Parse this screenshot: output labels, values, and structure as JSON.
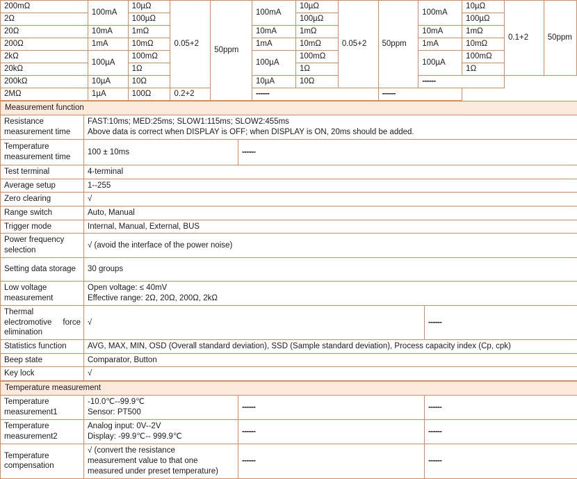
{
  "spec_table": {
    "top_ranges": {
      "group_a": {
        "ranges": [
          "200mΩ",
          "2Ω",
          "20Ω",
          "200Ω",
          "2kΩ",
          "20kΩ",
          "200kΩ",
          "2MΩ"
        ],
        "currents": [
          {
            "label": "100mA",
            "span": 2
          },
          {
            "label": "10mA",
            "span": 1
          },
          {
            "label": "1mA",
            "span": 1
          },
          {
            "label": "100µA",
            "span": 2
          },
          {
            "label": "10µA",
            "span": 1
          },
          {
            "label": "1µA",
            "span": 1
          }
        ],
        "resolutions": [
          "10µΩ",
          "100µΩ",
          "1mΩ",
          "10mΩ",
          "100mΩ",
          "1Ω",
          "10Ω",
          "100Ω"
        ],
        "accuracy_main": "0.05+2",
        "accuracy_last": "0.2+2",
        "tempco": "50ppm"
      },
      "group_b": {
        "currents": [
          {
            "label": "100mA",
            "span": 2
          },
          {
            "label": "10mA",
            "span": 1
          },
          {
            "label": "1mA",
            "span": 1
          },
          {
            "label": "100µA",
            "span": 2
          },
          {
            "label": "10µA",
            "span": 1
          }
        ],
        "resolutions": [
          "10µΩ",
          "100µΩ",
          "1mΩ",
          "10mΩ",
          "100mΩ",
          "1Ω",
          "10Ω"
        ],
        "last_dash": "------",
        "accuracy_main": "0.05+2",
        "tempco": "50ppm"
      },
      "group_c": {
        "currents": [
          {
            "label": "100mA",
            "span": 2
          },
          {
            "label": "10mA",
            "span": 1
          },
          {
            "label": "1mA",
            "span": 1
          },
          {
            "label": "100µA",
            "span": 2
          }
        ],
        "resolutions": [
          "10µΩ",
          "100µΩ",
          "1mΩ",
          "10mΩ",
          "100mΩ",
          "1Ω"
        ],
        "dash_rows": [
          "------",
          "------"
        ],
        "accuracy_main": "0.1+2",
        "tempco": "50ppm"
      }
    },
    "measurement_function": {
      "section_title": "Measurement function",
      "rows": [
        {
          "label": "Resistance measurement time",
          "value_line1": "FAST:10ms; MED:25ms; SLOW1:115ms; SLOW2:455ms",
          "value_line2": "Above data is correct when DISPLAY is OFF; when DISPLAY is ON, 20ms should be added.",
          "split": false
        },
        {
          "label": "Temperature measurement time",
          "value_line1": "100 ± 10ms",
          "value_line2": "",
          "split": true,
          "right_value": "------"
        },
        {
          "label": "Test terminal",
          "value_line1": "4-terminal",
          "value_line2": "",
          "split": false
        },
        {
          "label": "Average setup",
          "value_line1": "1--255",
          "value_line2": "",
          "split": false
        },
        {
          "label": "Zero clearing",
          "value_line1": "√",
          "value_line2": "",
          "split": false
        },
        {
          "label": "Range switch",
          "value_line1": "Auto, Manual",
          "value_line2": "",
          "split": false
        },
        {
          "label": "Trigger mode",
          "value_line1": "Internal, Manual, External, BUS",
          "value_line2": "",
          "split": false
        },
        {
          "label": "Power frequency selection",
          "value_line1": "√ (avoid the interface of the power noise)",
          "value_line2": "",
          "split": false
        },
        {
          "label": "Setting data storage",
          "value_line1": "30 groups",
          "value_line2": "",
          "split": false
        },
        {
          "label": "Low voltage measurement",
          "value_line1": "Open voltage: ≤ 40mV",
          "value_line2": "Effective range: 2Ω, 20Ω, 200Ω, 2kΩ",
          "split": false
        },
        {
          "label": "Thermal electromotive force elimination",
          "value_line1": "√",
          "value_line2": "",
          "split": true,
          "right_value": "------"
        },
        {
          "label": "Statistics function",
          "value_line1": "AVG, MAX, MIN, OSD (Overall standard deviation), SSD (Sample standard deviation), Process capacity index (Cp, cpk)",
          "value_line2": "",
          "split": false
        },
        {
          "label": "Beep state",
          "value_line1": "Comparator, Button",
          "value_line2": "",
          "split": false
        },
        {
          "label": "Key lock",
          "value_line1": "√",
          "value_line2": "",
          "split": false
        }
      ]
    },
    "temperature_measurement": {
      "section_title": "Temperature measurement",
      "rows": [
        {
          "label": "Temperature measurement1",
          "value_line1": "-10.0℃--99.9℃",
          "value_line2": "Sensor: PT500",
          "value_line3": "",
          "col3": "------",
          "col4": "------"
        },
        {
          "label": "Temperature measurement2",
          "value_line1": "Analog input: 0V--2V",
          "value_line2": "Display: -99.9℃-- 999.9℃",
          "value_line3": "",
          "col3": "------",
          "col4": "------"
        },
        {
          "label": "Temperature compensation",
          "value_line1": "√ (convert the resistance",
          "value_line2": "measurement value to that one",
          "value_line3": "measured under preset temperature)",
          "col3": "------",
          "col4": "------"
        }
      ]
    }
  },
  "colors": {
    "border": "#e08a5c",
    "header_bg": "#fdeadd",
    "text": "#1a1a1a"
  }
}
